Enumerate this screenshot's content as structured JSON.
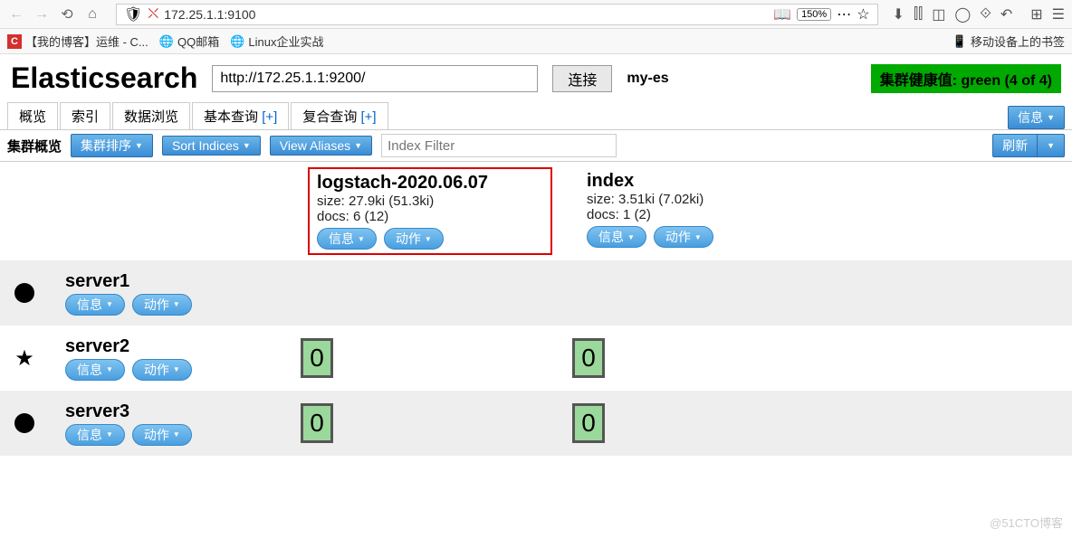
{
  "browser": {
    "url": "172.25.1.1:9100",
    "zoom": "150%",
    "bookmarks": [
      {
        "icon": "red-c",
        "label": "【我的博客】运维 - C..."
      },
      {
        "icon": "globe",
        "label": "QQ邮箱"
      },
      {
        "icon": "globe",
        "label": "Linux企业实战"
      }
    ],
    "rightBookmark": "移动设备上的书签"
  },
  "es": {
    "title": "Elasticsearch",
    "urlValue": "http://172.25.1.1:9200/",
    "connectLabel": "连接",
    "clusterName": "my-es",
    "healthText": "集群健康值: green (4 of 4)"
  },
  "tabs": [
    {
      "label": "概览"
    },
    {
      "label": "索引"
    },
    {
      "label": "数据浏览"
    },
    {
      "label": "基本查询 ",
      "plus": "[+]"
    },
    {
      "label": "复合查询 ",
      "plus": "[+]"
    }
  ],
  "infoBtnLabel": "信息",
  "toolbar": {
    "label": "集群概览",
    "sortCluster": "集群排序",
    "sortIndices": "Sort Indices",
    "viewAliases": "View Aliases",
    "filterPlaceholder": "Index Filter",
    "refresh": "刷新"
  },
  "indices": [
    {
      "name": "logstach-2020.06.07",
      "size": "size: 27.9ki (51.3ki)",
      "docs": "docs: 6 (12)",
      "highlighted": true
    },
    {
      "name": "index",
      "size": "size: 3.51ki (7.02ki)",
      "docs": "docs: 1 (2)",
      "highlighted": false
    }
  ],
  "pill": {
    "info": "信息",
    "action": "动作"
  },
  "nodes": [
    {
      "name": "server1",
      "icon": "circle",
      "shards": [
        null,
        null
      ],
      "shaded": true
    },
    {
      "name": "server2",
      "icon": "star",
      "shards": [
        "0",
        "0"
      ],
      "shaded": false
    },
    {
      "name": "server3",
      "icon": "circle",
      "shards": [
        "0",
        "0"
      ],
      "shaded": true
    }
  ],
  "watermark": "@51CTO博客"
}
